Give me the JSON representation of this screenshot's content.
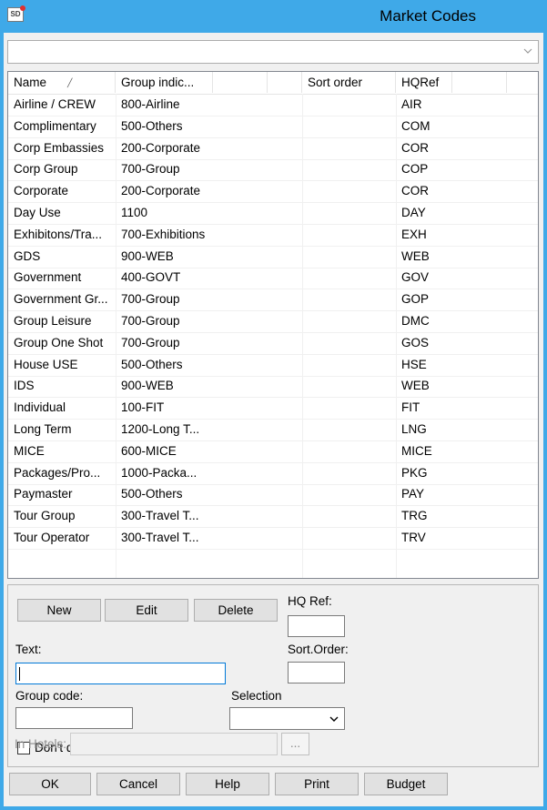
{
  "window": {
    "title": "Market Codes",
    "icon_text": "SD"
  },
  "filter_combo": {
    "value": ""
  },
  "grid": {
    "columns": [
      "Name",
      "Group indic...",
      "",
      "",
      "Sort order",
      "HQRef",
      ""
    ],
    "sort_column": "Name",
    "rows": [
      {
        "name": "Airline / CREW",
        "group": "800-Airline",
        "sort": "",
        "hq": "AIR"
      },
      {
        "name": "Complimentary",
        "group": "500-Others",
        "sort": "",
        "hq": "COM"
      },
      {
        "name": "Corp Embassies",
        "group": "200-Corporate",
        "sort": "",
        "hq": "COR"
      },
      {
        "name": "Corp Group",
        "group": "700-Group",
        "sort": "",
        "hq": "COP"
      },
      {
        "name": "Corporate",
        "group": "200-Corporate",
        "sort": "",
        "hq": "COR"
      },
      {
        "name": "Day Use",
        "group": "1100",
        "sort": "",
        "hq": "DAY"
      },
      {
        "name": "Exhibitons/Tra...",
        "group": "700-Exhibitions",
        "sort": "",
        "hq": "EXH"
      },
      {
        "name": "GDS",
        "group": "900-WEB",
        "sort": "",
        "hq": "WEB"
      },
      {
        "name": "Government",
        "group": "400-GOVT",
        "sort": "",
        "hq": "GOV"
      },
      {
        "name": "Government Gr...",
        "group": "700-Group",
        "sort": "",
        "hq": "GOP"
      },
      {
        "name": "Group Leisure",
        "group": "700-Group",
        "sort": "",
        "hq": "DMC"
      },
      {
        "name": "Group One Shot",
        "group": "700-Group",
        "sort": "",
        "hq": "GOS"
      },
      {
        "name": "House USE",
        "group": "500-Others",
        "sort": "",
        "hq": "HSE"
      },
      {
        "name": "IDS",
        "group": "900-WEB",
        "sort": "",
        "hq": "WEB"
      },
      {
        "name": "Individual",
        "group": "100-FIT",
        "sort": "",
        "hq": "FIT"
      },
      {
        "name": "Long Term",
        "group": "1200-Long T...",
        "sort": "",
        "hq": "LNG"
      },
      {
        "name": "MICE",
        "group": "600-MICE",
        "sort": "",
        "hq": "MICE"
      },
      {
        "name": "Packages/Pro...",
        "group": "1000-Packa...",
        "sort": "",
        "hq": "PKG"
      },
      {
        "name": "Paymaster",
        "group": "500-Others",
        "sort": "",
        "hq": "PAY"
      },
      {
        "name": "Tour Group",
        "group": "300-Travel T...",
        "sort": "",
        "hq": "TRG"
      },
      {
        "name": "Tour Operator",
        "group": "300-Travel T...",
        "sort": "",
        "hq": "TRV"
      }
    ]
  },
  "edit_panel": {
    "new_label": "New",
    "edit_label": "Edit",
    "delete_label": "Delete",
    "hq_ref_label": "HQ Ref:",
    "hq_ref_value": "",
    "text_label": "Text:",
    "text_value": "",
    "sort_order_label": "Sort.Order:",
    "sort_order_value": "",
    "group_code_label": "Group code:",
    "group_code_value": "",
    "selection_label": "Selection",
    "selection_value": "",
    "dont_display_label": "Don't display in FO",
    "dont_display_checked": false,
    "in_hotels_label": "In Hotels:",
    "in_hotels_value": "",
    "browse_label": "..."
  },
  "footer_buttons": {
    "ok": "OK",
    "cancel": "Cancel",
    "help": "Help",
    "print": "Print",
    "budget": "Budget"
  }
}
